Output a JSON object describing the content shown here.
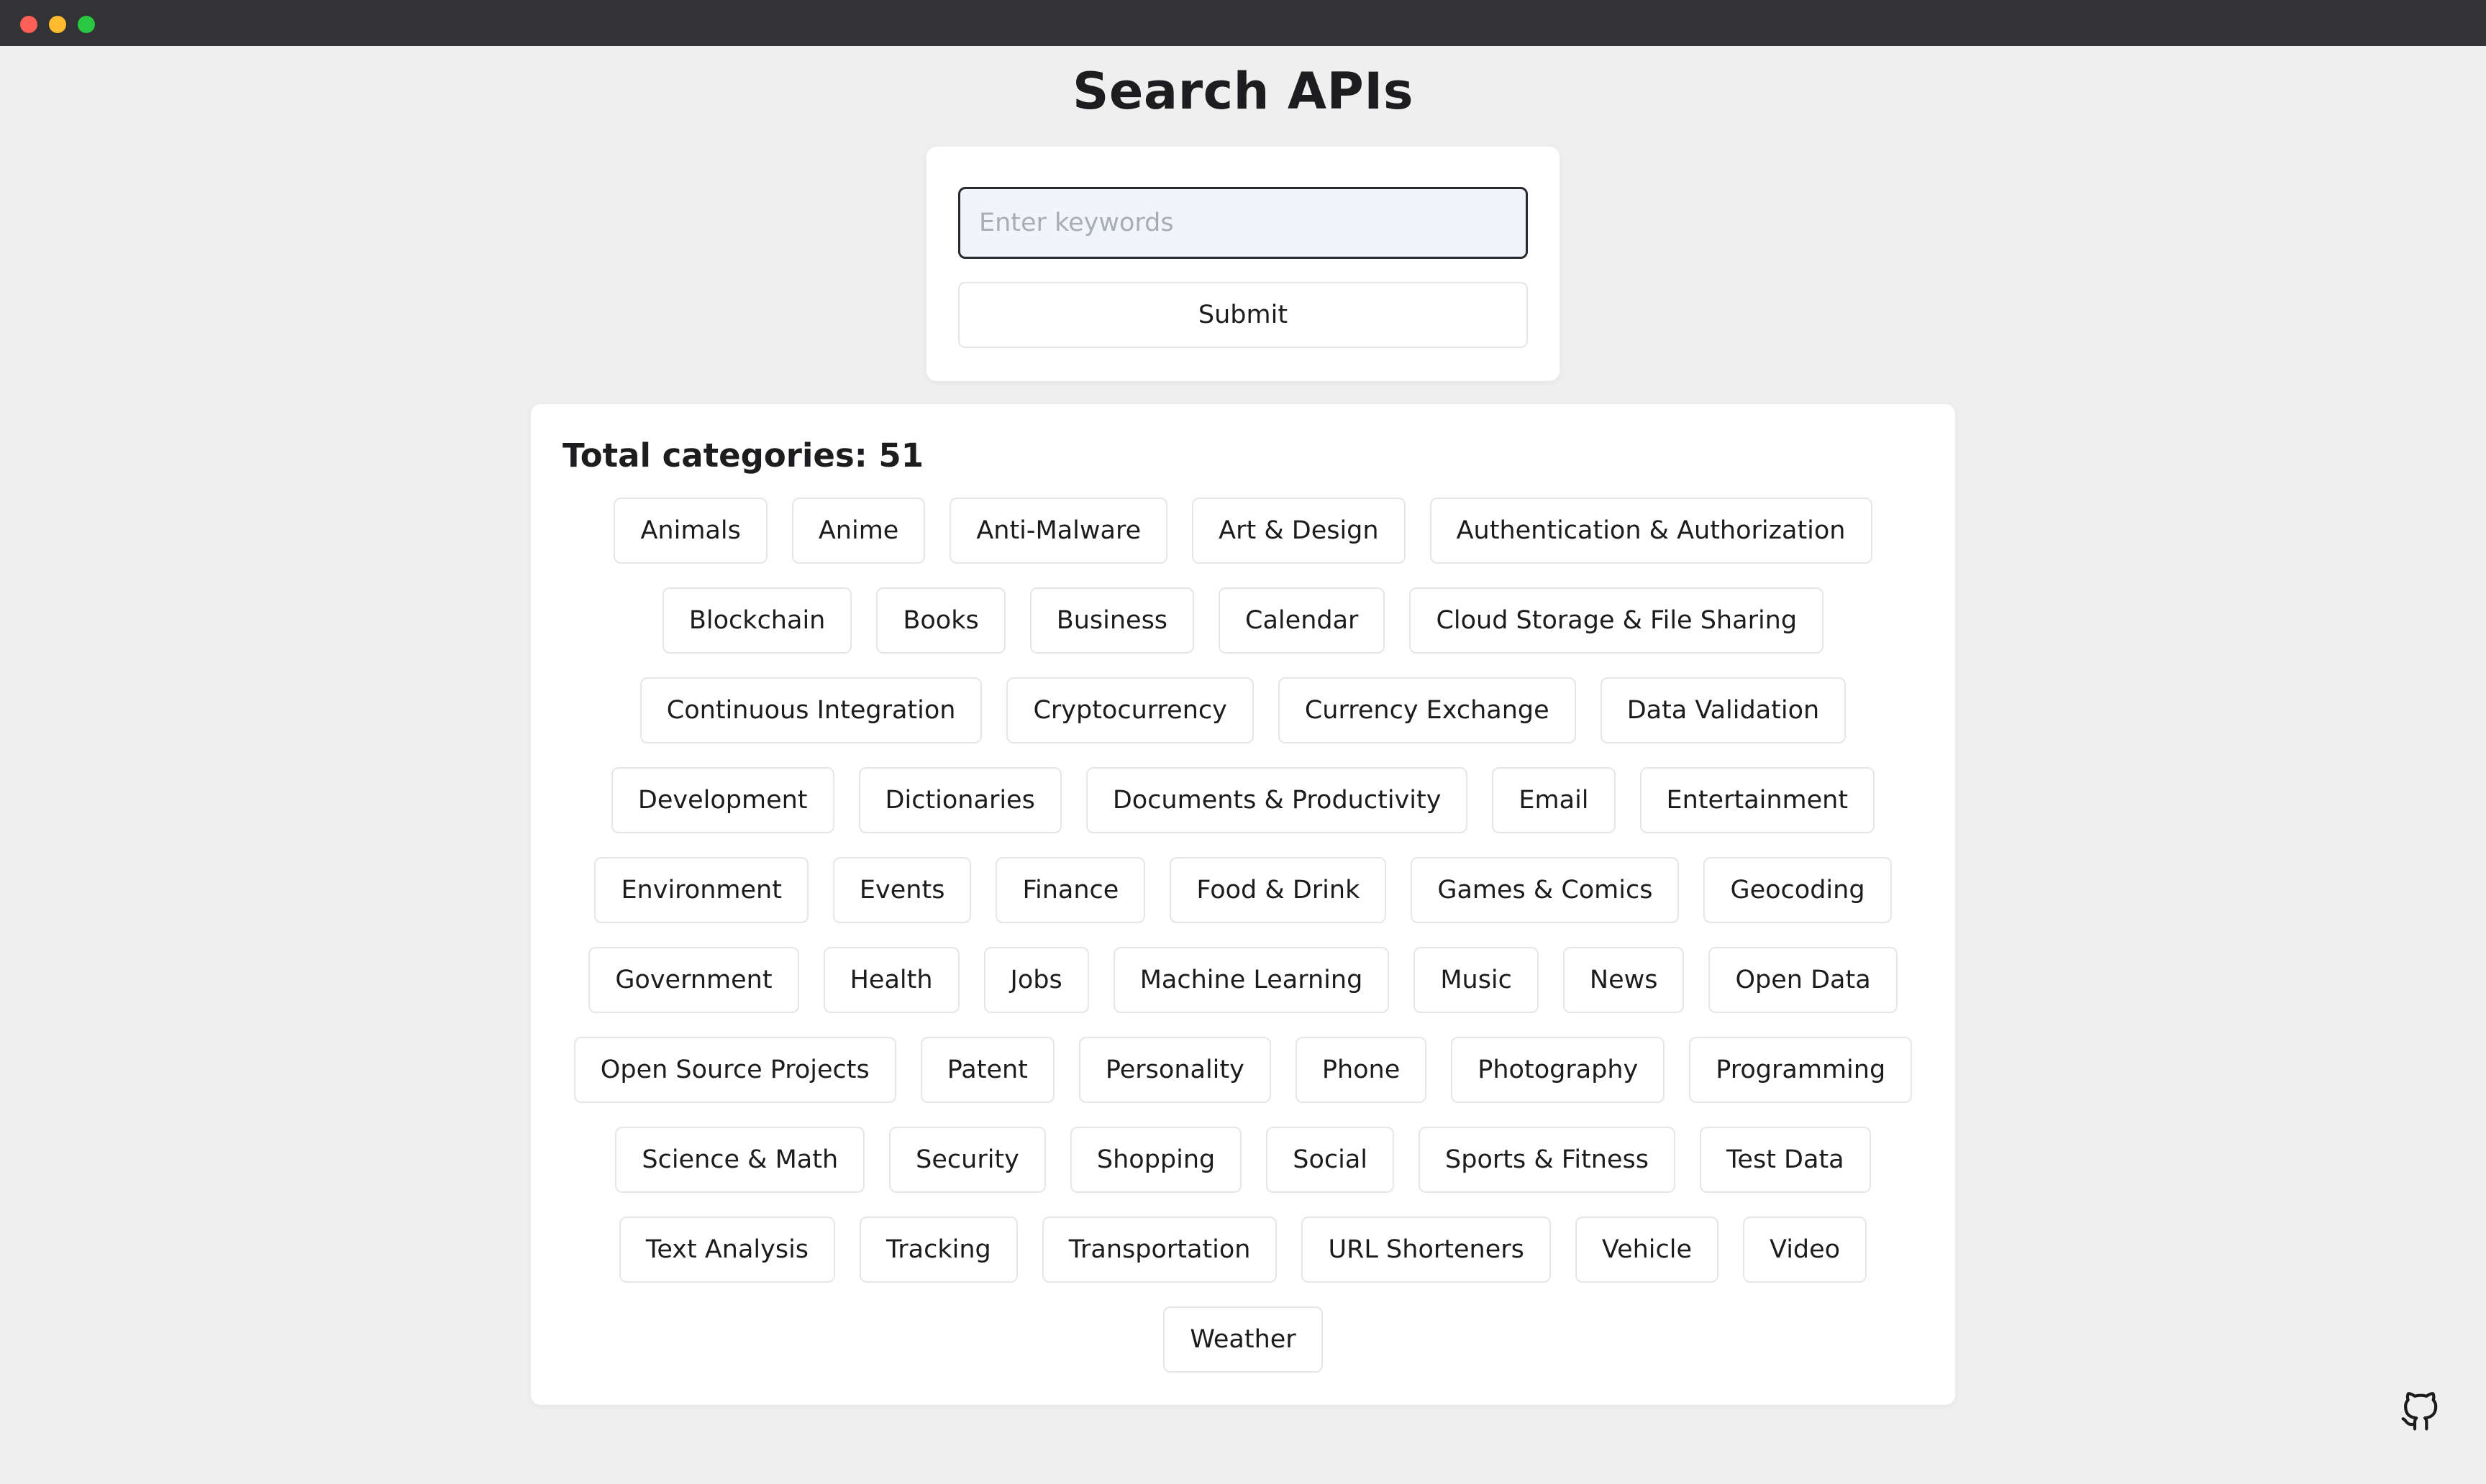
{
  "window": {
    "controls": [
      "close",
      "minimize",
      "maximize"
    ]
  },
  "header": {
    "title": "Search APIs"
  },
  "search": {
    "placeholder": "Enter keywords",
    "value": "",
    "submit_label": "Submit"
  },
  "categories": {
    "total_label": "Total categories: 51",
    "rows": [
      [
        "Animals",
        "Anime",
        "Anti-Malware",
        "Art & Design",
        "Authentication & Authorization"
      ],
      [
        "Blockchain",
        "Books",
        "Business",
        "Calendar",
        "Cloud Storage & File Sharing"
      ],
      [
        "Continuous Integration",
        "Cryptocurrency",
        "Currency Exchange",
        "Data Validation"
      ],
      [
        "Development",
        "Dictionaries",
        "Documents & Productivity",
        "Email",
        "Entertainment"
      ],
      [
        "Environment",
        "Events",
        "Finance",
        "Food & Drink",
        "Games & Comics",
        "Geocoding"
      ],
      [
        "Government",
        "Health",
        "Jobs",
        "Machine Learning",
        "Music",
        "News",
        "Open Data"
      ],
      [
        "Open Source Projects",
        "Patent",
        "Personality",
        "Phone",
        "Photography",
        "Programming"
      ],
      [
        "Science & Math",
        "Security",
        "Shopping",
        "Social",
        "Sports & Fitness",
        "Test Data"
      ],
      [
        "Text Analysis",
        "Tracking",
        "Transportation",
        "URL Shorteners",
        "Vehicle",
        "Video"
      ],
      [
        "Weather"
      ]
    ]
  },
  "footer": {
    "icon": "github-icon"
  },
  "colors": {
    "background": "#efefef",
    "card": "#ffffff",
    "titlebar": "#333336",
    "input_border": "#2a2a2e",
    "input_fill": "#f1f4f8",
    "tag_border": "#e6e6e8"
  }
}
